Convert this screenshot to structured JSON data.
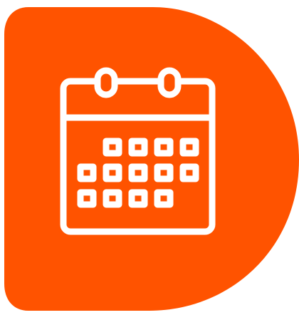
{
  "icon": {
    "name": "calendar-icon",
    "shape": "rounded-d-badge"
  },
  "colors": {
    "badge": "#FF5300",
    "stroke": "#FFFFFF",
    "background": "#FFFFFF"
  },
  "calendar": {
    "rings": 2,
    "grid_rows": [
      4,
      5,
      4
    ]
  }
}
